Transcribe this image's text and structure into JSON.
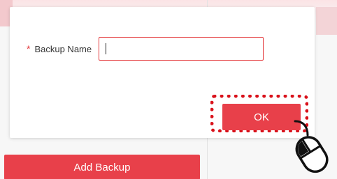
{
  "dialog": {
    "required_mark": "*",
    "field_label": "Backup Name",
    "field_value": "",
    "ok_label": "OK"
  },
  "footer": {
    "add_backup_label": "Add Backup"
  },
  "colors": {
    "accent": "#e8404a",
    "highlight": "#d9111a",
    "required": "#e4393c"
  },
  "icons": {
    "pointer": "mouse-click-icon"
  }
}
